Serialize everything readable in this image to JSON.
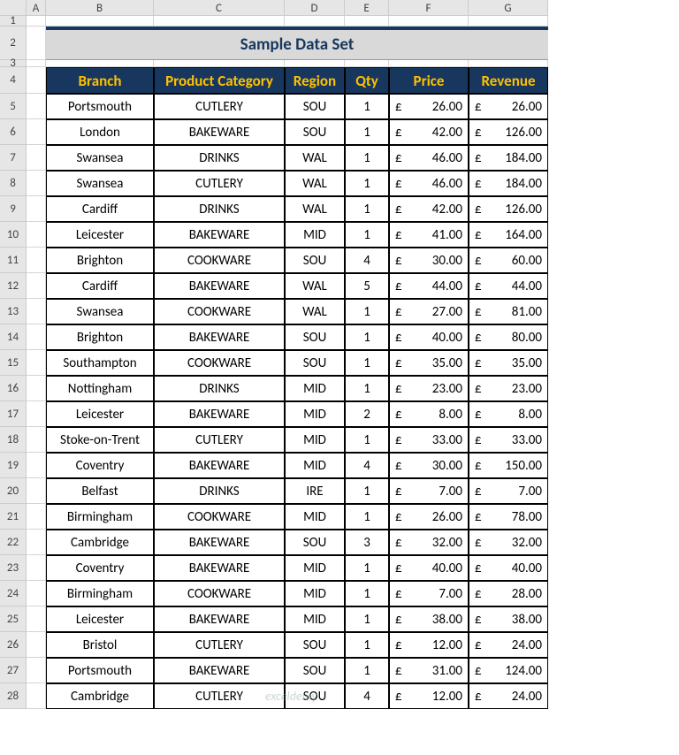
{
  "columns": [
    "A",
    "B",
    "C",
    "D",
    "E",
    "F",
    "G"
  ],
  "title": "Sample Data Set",
  "headers": [
    "Branch",
    "Product Category",
    "Region",
    "Qty",
    "Price",
    "Revenue"
  ],
  "currency": "£",
  "rows": [
    {
      "n": 5,
      "branch": "Portsmouth",
      "cat": "CUTLERY",
      "reg": "SOU",
      "qty": 1,
      "price": "26.00",
      "rev": "26.00"
    },
    {
      "n": 6,
      "branch": "London",
      "cat": "BAKEWARE",
      "reg": "SOU",
      "qty": 1,
      "price": "42.00",
      "rev": "126.00"
    },
    {
      "n": 7,
      "branch": "Swansea",
      "cat": "DRINKS",
      "reg": "WAL",
      "qty": 1,
      "price": "46.00",
      "rev": "184.00"
    },
    {
      "n": 8,
      "branch": "Swansea",
      "cat": "CUTLERY",
      "reg": "WAL",
      "qty": 1,
      "price": "46.00",
      "rev": "184.00"
    },
    {
      "n": 9,
      "branch": "Cardiff",
      "cat": "DRINKS",
      "reg": "WAL",
      "qty": 1,
      "price": "42.00",
      "rev": "126.00"
    },
    {
      "n": 10,
      "branch": "Leicester",
      "cat": "BAKEWARE",
      "reg": "MID",
      "qty": 1,
      "price": "41.00",
      "rev": "164.00"
    },
    {
      "n": 11,
      "branch": "Brighton",
      "cat": "COOKWARE",
      "reg": "SOU",
      "qty": 4,
      "price": "30.00",
      "rev": "60.00"
    },
    {
      "n": 12,
      "branch": "Cardiff",
      "cat": "BAKEWARE",
      "reg": "WAL",
      "qty": 5,
      "price": "44.00",
      "rev": "44.00"
    },
    {
      "n": 13,
      "branch": "Swansea",
      "cat": "COOKWARE",
      "reg": "WAL",
      "qty": 1,
      "price": "27.00",
      "rev": "81.00"
    },
    {
      "n": 14,
      "branch": "Brighton",
      "cat": "BAKEWARE",
      "reg": "SOU",
      "qty": 1,
      "price": "40.00",
      "rev": "80.00"
    },
    {
      "n": 15,
      "branch": "Southampton",
      "cat": "COOKWARE",
      "reg": "SOU",
      "qty": 1,
      "price": "35.00",
      "rev": "35.00"
    },
    {
      "n": 16,
      "branch": "Nottingham",
      "cat": "DRINKS",
      "reg": "MID",
      "qty": 1,
      "price": "23.00",
      "rev": "23.00"
    },
    {
      "n": 17,
      "branch": "Leicester",
      "cat": "BAKEWARE",
      "reg": "MID",
      "qty": 2,
      "price": "8.00",
      "rev": "8.00"
    },
    {
      "n": 18,
      "branch": "Stoke-on-Trent",
      "cat": "CUTLERY",
      "reg": "MID",
      "qty": 1,
      "price": "33.00",
      "rev": "33.00"
    },
    {
      "n": 19,
      "branch": "Coventry",
      "cat": "BAKEWARE",
      "reg": "MID",
      "qty": 4,
      "price": "30.00",
      "rev": "150.00"
    },
    {
      "n": 20,
      "branch": "Belfast",
      "cat": "DRINKS",
      "reg": "IRE",
      "qty": 1,
      "price": "7.00",
      "rev": "7.00"
    },
    {
      "n": 21,
      "branch": "Birmingham",
      "cat": "COOKWARE",
      "reg": "MID",
      "qty": 1,
      "price": "26.00",
      "rev": "78.00"
    },
    {
      "n": 22,
      "branch": "Cambridge",
      "cat": "BAKEWARE",
      "reg": "SOU",
      "qty": 3,
      "price": "32.00",
      "rev": "32.00"
    },
    {
      "n": 23,
      "branch": "Coventry",
      "cat": "BAKEWARE",
      "reg": "MID",
      "qty": 1,
      "price": "40.00",
      "rev": "40.00"
    },
    {
      "n": 24,
      "branch": "Birmingham",
      "cat": "COOKWARE",
      "reg": "MID",
      "qty": 1,
      "price": "7.00",
      "rev": "28.00"
    },
    {
      "n": 25,
      "branch": "Leicester",
      "cat": "BAKEWARE",
      "reg": "MID",
      "qty": 1,
      "price": "38.00",
      "rev": "38.00"
    },
    {
      "n": 26,
      "branch": "Bristol",
      "cat": "CUTLERY",
      "reg": "SOU",
      "qty": 1,
      "price": "12.00",
      "rev": "24.00"
    },
    {
      "n": 27,
      "branch": "Portsmouth",
      "cat": "BAKEWARE",
      "reg": "SOU",
      "qty": 1,
      "price": "31.00",
      "rev": "124.00"
    },
    {
      "n": 28,
      "branch": "Cambridge",
      "cat": "CUTLERY",
      "reg": "SOU",
      "qty": 4,
      "price": "12.00",
      "rev": "24.00"
    }
  ],
  "watermark": "exceldemy"
}
